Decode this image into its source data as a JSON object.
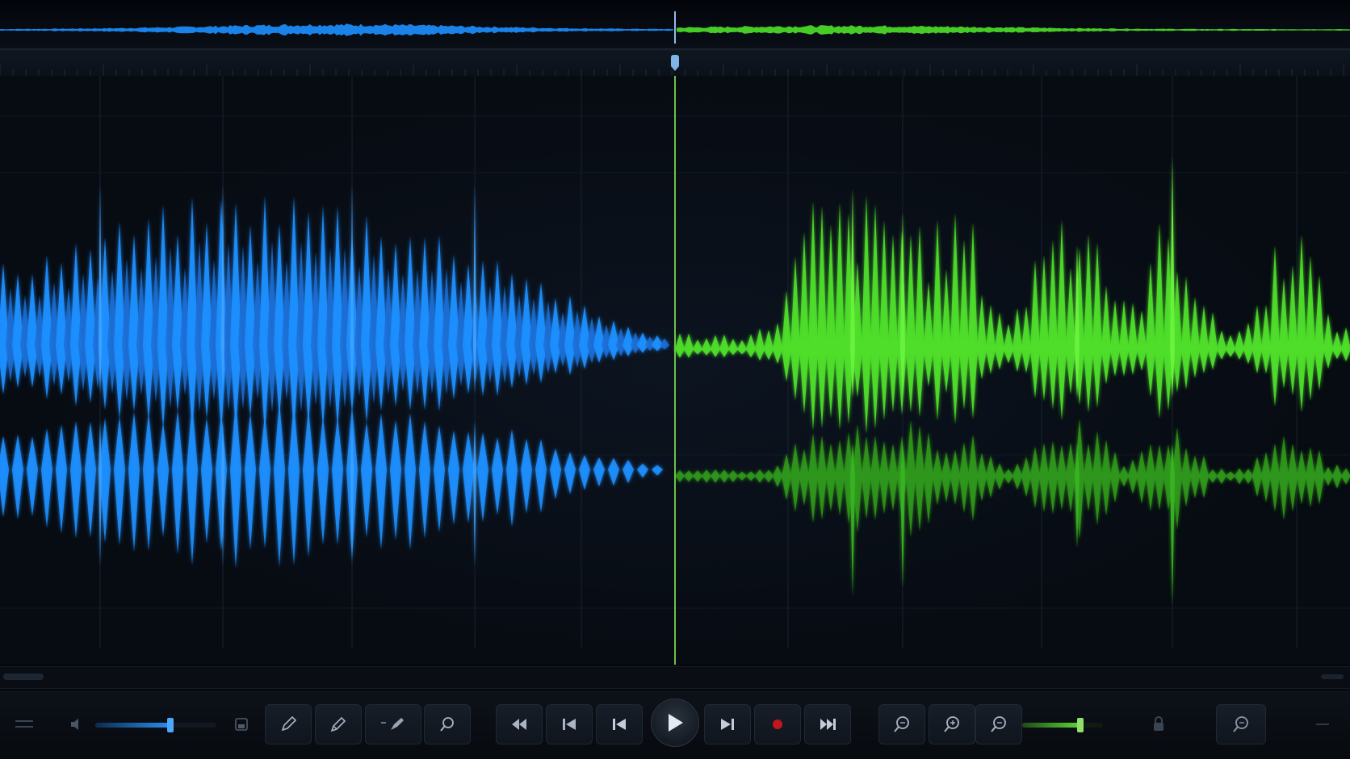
{
  "window": {
    "title": ""
  },
  "colors": {
    "left_track": "#1e8fff",
    "right_track": "#4fe02a",
    "playhead": "#6cc24a",
    "record": "#c0171c",
    "background": "#070b11"
  },
  "playhead": {
    "position_fraction": 0.5
  },
  "volume_slider": {
    "level": 0.62
  },
  "gain_slider": {
    "level": 0.72
  },
  "icons": {
    "menu": "menu-icon",
    "speaker": "speaker-icon",
    "save": "save-icon",
    "pencil": "pencil-icon",
    "pen": "pen-icon",
    "brush": "brush-icon",
    "search": "search-icon",
    "rewind": "rewind-icon",
    "skip_start": "skip-start-icon",
    "step_back": "step-back-icon",
    "play": "play-icon",
    "step_forward": "step-forward-icon",
    "record": "record-icon",
    "skip_end": "skip-end-icon",
    "zoom_fit": "zoom-fit-icon",
    "zoom_in": "zoom-in-icon",
    "zoom_out": "zoom-out-icon",
    "lock": "lock-icon",
    "zoom_reset": "zoom-reset-icon",
    "minimize": "minimize-icon"
  }
}
